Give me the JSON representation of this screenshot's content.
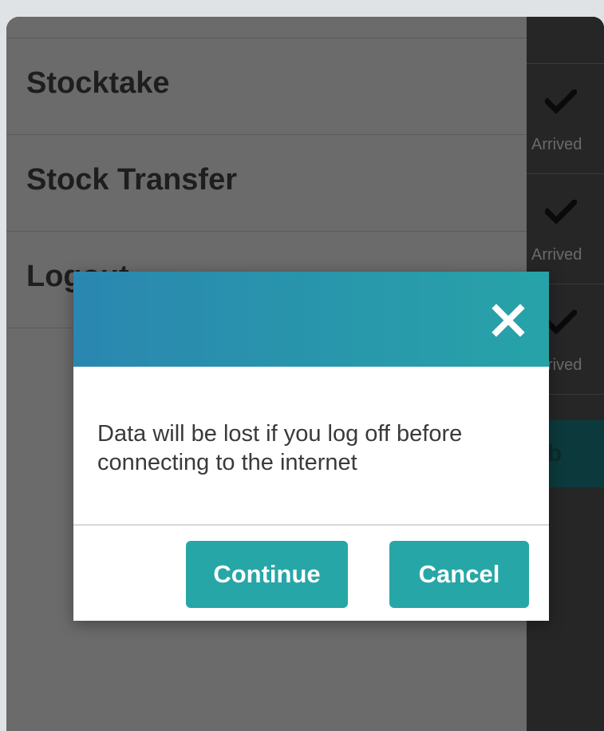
{
  "drawer": {
    "items": [
      {
        "label": "Stocktake"
      },
      {
        "label": "Stock Transfer"
      },
      {
        "label": "Logout"
      }
    ]
  },
  "background_list": {
    "rows": [
      {
        "status_icon": "check-icon",
        "status": "Arrived"
      },
      {
        "status_icon": "check-icon",
        "status": "Arrived"
      },
      {
        "status_icon": "check-icon",
        "status": "Arrived"
      }
    ],
    "button_fragment": "b"
  },
  "dialog": {
    "close_icon": "close-icon",
    "message": "Data will be lost if you log off before connecting to the internet",
    "continue_label": "Continue",
    "cancel_label": "Cancel"
  },
  "colors": {
    "accent": "#27a6a7",
    "header_gradient_start": "#2a87b0",
    "header_gradient_end": "#27a3a8",
    "overlay": "#6b6b6b"
  }
}
